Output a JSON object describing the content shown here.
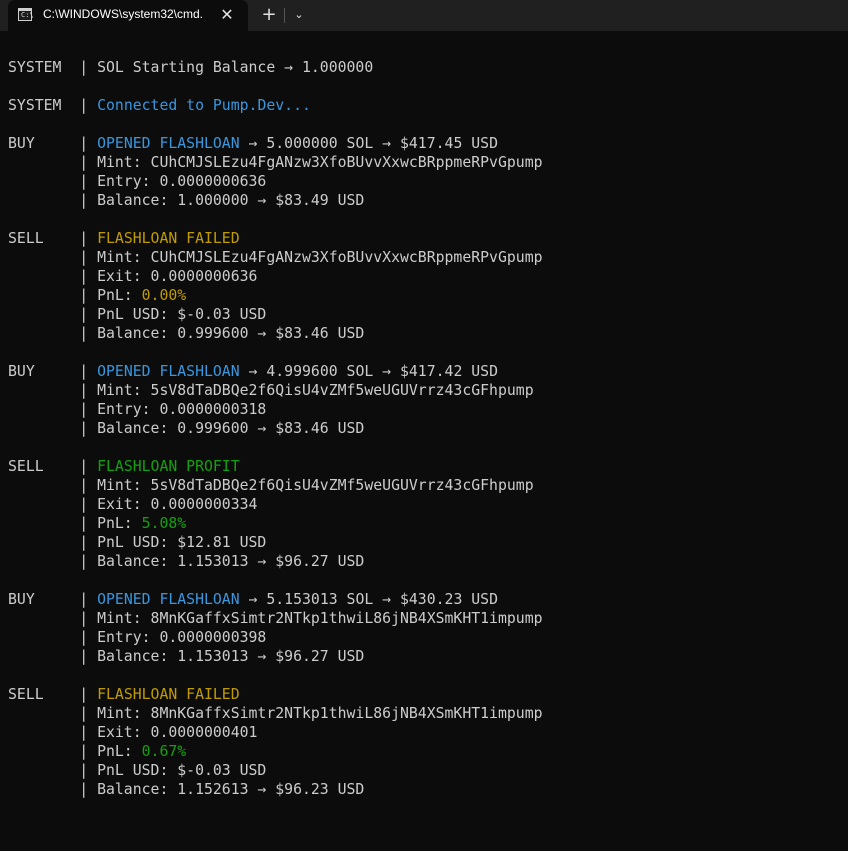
{
  "window": {
    "tab_title": "C:\\WINDOWS\\system32\\cmd.",
    "tab_icon": "cmd-icon",
    "close_glyph": "✕",
    "new_tab_glyph": "+",
    "dropdown_glyph": "⌄"
  },
  "colors": {
    "blue": "#3a96dd",
    "yellow": "#c19c00",
    "green": "#13a10e",
    "text": "#cccccc",
    "background": "#0c0c0c"
  },
  "console": {
    "lines": [
      [
        {
          "t": "SYSTEM  | SOL Starting Balance → 1.000000",
          "c": "default"
        }
      ],
      [],
      [
        {
          "t": "SYSTEM  | ",
          "c": "default"
        },
        {
          "t": "Connected to Pump.Dev...",
          "c": "blue"
        }
      ],
      [],
      [
        {
          "t": "BUY     | ",
          "c": "default"
        },
        {
          "t": "OPENED FLASHLOAN",
          "c": "blue"
        },
        {
          "t": " → 5.000000 SOL → $417.45 USD",
          "c": "default"
        }
      ],
      [
        {
          "t": "        | Mint: CUhCMJSLEzu4FgANzw3XfoBUvvXxwcBRppmeRPvGpump",
          "c": "default"
        }
      ],
      [
        {
          "t": "        | Entry: 0.0000000636",
          "c": "default"
        }
      ],
      [
        {
          "t": "        | Balance: 1.000000 → $83.49 USD",
          "c": "default"
        }
      ],
      [],
      [
        {
          "t": "SELL    | ",
          "c": "default"
        },
        {
          "t": "FLASHLOAN FAILED",
          "c": "yellow"
        }
      ],
      [
        {
          "t": "        | Mint: CUhCMJSLEzu4FgANzw3XfoBUvvXxwcBRppmeRPvGpump",
          "c": "default"
        }
      ],
      [
        {
          "t": "        | Exit: 0.0000000636",
          "c": "default"
        }
      ],
      [
        {
          "t": "        | PnL: ",
          "c": "default"
        },
        {
          "t": "0.00%",
          "c": "yellow"
        }
      ],
      [
        {
          "t": "        | PnL USD: $-0.03 USD",
          "c": "default"
        }
      ],
      [
        {
          "t": "        | Balance: 0.999600 → $83.46 USD",
          "c": "default"
        }
      ],
      [],
      [
        {
          "t": "BUY     | ",
          "c": "default"
        },
        {
          "t": "OPENED FLASHLOAN",
          "c": "blue"
        },
        {
          "t": " → 4.999600 SOL → $417.42 USD",
          "c": "default"
        }
      ],
      [
        {
          "t": "        | Mint: 5sV8dTaDBQe2f6QisU4vZMf5weUGUVrrz43cGFhpump",
          "c": "default"
        }
      ],
      [
        {
          "t": "        | Entry: 0.0000000318",
          "c": "default"
        }
      ],
      [
        {
          "t": "        | Balance: 0.999600 → $83.46 USD",
          "c": "default"
        }
      ],
      [],
      [
        {
          "t": "SELL    | ",
          "c": "default"
        },
        {
          "t": "FLASHLOAN PROFIT",
          "c": "green"
        }
      ],
      [
        {
          "t": "        | Mint: 5sV8dTaDBQe2f6QisU4vZMf5weUGUVrrz43cGFhpump",
          "c": "default"
        }
      ],
      [
        {
          "t": "        | Exit: 0.0000000334",
          "c": "default"
        }
      ],
      [
        {
          "t": "        | PnL: ",
          "c": "default"
        },
        {
          "t": "5.08%",
          "c": "green"
        }
      ],
      [
        {
          "t": "        | PnL USD: $12.81 USD",
          "c": "default"
        }
      ],
      [
        {
          "t": "        | Balance: 1.153013 → $96.27 USD",
          "c": "default"
        }
      ],
      [],
      [
        {
          "t": "BUY     | ",
          "c": "default"
        },
        {
          "t": "OPENED FLASHLOAN",
          "c": "blue"
        },
        {
          "t": " → 5.153013 SOL → $430.23 USD",
          "c": "default"
        }
      ],
      [
        {
          "t": "        | Mint: 8MnKGaffxSimtr2NTkp1thwiL86jNB4XSmKHT1impump",
          "c": "default"
        }
      ],
      [
        {
          "t": "        | Entry: 0.0000000398",
          "c": "default"
        }
      ],
      [
        {
          "t": "        | Balance: 1.153013 → $96.27 USD",
          "c": "default"
        }
      ],
      [],
      [
        {
          "t": "SELL    | ",
          "c": "default"
        },
        {
          "t": "FLASHLOAN FAILED",
          "c": "yellow"
        }
      ],
      [
        {
          "t": "        | Mint: 8MnKGaffxSimtr2NTkp1thwiL86jNB4XSmKHT1impump",
          "c": "default"
        }
      ],
      [
        {
          "t": "        | Exit: 0.0000000401",
          "c": "default"
        }
      ],
      [
        {
          "t": "        | PnL: ",
          "c": "default"
        },
        {
          "t": "0.67%",
          "c": "green"
        }
      ],
      [
        {
          "t": "        | PnL USD: $-0.03 USD",
          "c": "default"
        }
      ],
      [
        {
          "t": "        | Balance: 1.152613 → $96.23 USD",
          "c": "default"
        }
      ]
    ]
  }
}
